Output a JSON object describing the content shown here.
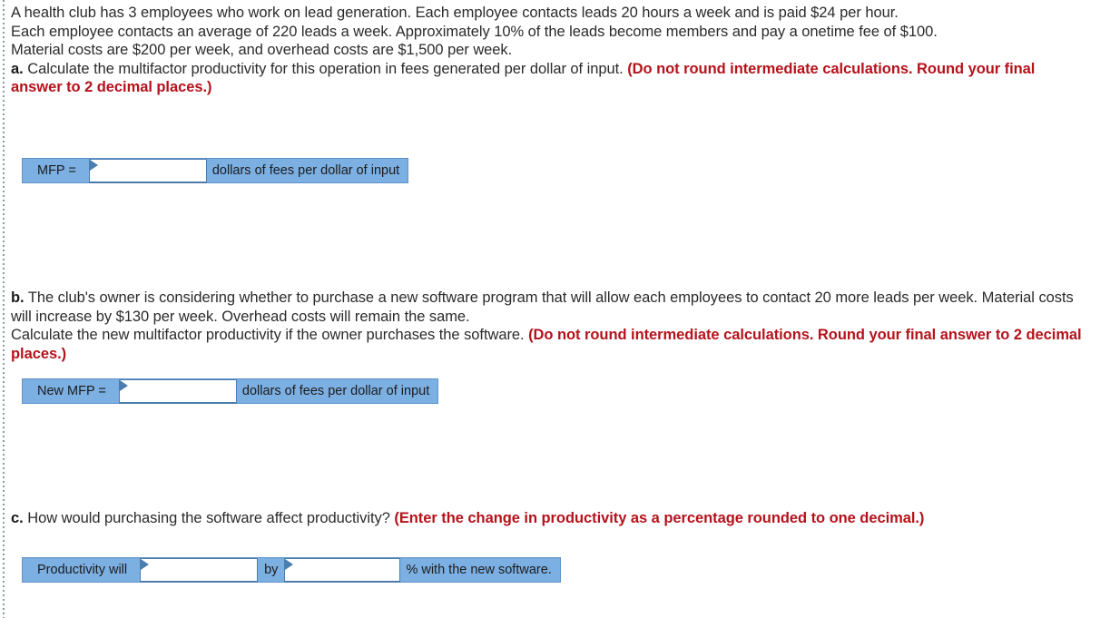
{
  "problem": {
    "line1": "A health club has 3 employees who work on lead generation. Each employee contacts leads 20 hours a week and is paid $24 per hour.",
    "line2": "Each employee contacts an average of 220 leads a week. Approximately 10% of the leads become members and pay a onetime fee of $100.",
    "line3": "Material costs are $200 per week, and overhead costs are $1,500 per week."
  },
  "part_a": {
    "marker": "a.",
    "question": " Calculate the multifactor productivity for this operation in fees generated per dollar of input. ",
    "instruction": "(Do not round intermediate calculations. Round your final answer to 2 decimal places.)",
    "answer_row": {
      "label": "MFP =",
      "input_value": "",
      "input_placeholder": "",
      "unit": "dollars of fees per dollar of input"
    }
  },
  "part_b": {
    "marker": "b.",
    "question_line1": " The club's owner is considering whether to purchase a new software program that will allow each employees to contact 20 more leads per week. Material costs will increase by $130 per week. Overhead costs will remain the same.",
    "question_line2": "Calculate the new multifactor productivity if the owner purchases the software. ",
    "instruction": "(Do not round intermediate calculations. Round your final answer to 2 decimal places.)",
    "answer_row": {
      "label": "New MFP =",
      "input_value": "",
      "input_placeholder": "",
      "unit": "dollars of fees per dollar of input"
    }
  },
  "part_c": {
    "marker": "c.",
    "question": " How would purchasing the software affect productivity? ",
    "instruction": "(Enter the change in productivity as a percentage rounded to one decimal.)",
    "answer_row": {
      "label": "Productivity will",
      "input_value_1": "",
      "input_placeholder_1": "",
      "connector": "by",
      "input_value_2": "",
      "input_placeholder_2": "",
      "unit": "% with the new software."
    }
  },
  "colors": {
    "instruction_red": "#b5121b",
    "answer_strip_blue": "#7cafe2",
    "field_border_blue": "#4a7db0",
    "body_text": "#2b2b2b"
  }
}
